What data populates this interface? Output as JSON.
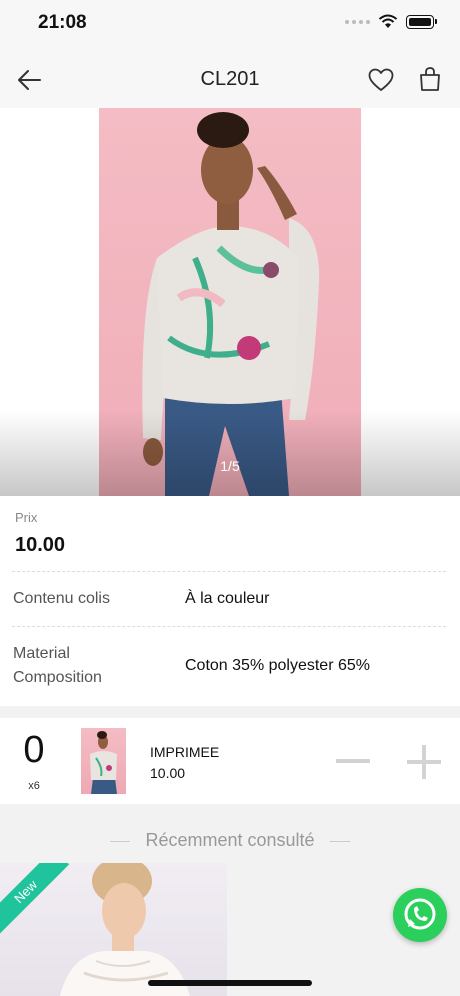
{
  "status_bar": {
    "time": "21:08"
  },
  "header": {
    "title": "CL201"
  },
  "gallery": {
    "pager": "1/5"
  },
  "price": {
    "label": "Prix",
    "value": "10.00"
  },
  "details": [
    {
      "label": "Contenu colis",
      "value": "À la couleur"
    },
    {
      "label": "Material\nComposition",
      "value": "Coton 35% polyester 65%"
    }
  ],
  "variant": {
    "quantity": "0",
    "pack": "x6",
    "name": "IMPRIMEE",
    "price": "10.00"
  },
  "recent": {
    "title": "Récemment consulté",
    "badge": "New"
  },
  "colors": {
    "accent_green": "#1fc49c",
    "whatsapp": "#2bcf5c"
  }
}
